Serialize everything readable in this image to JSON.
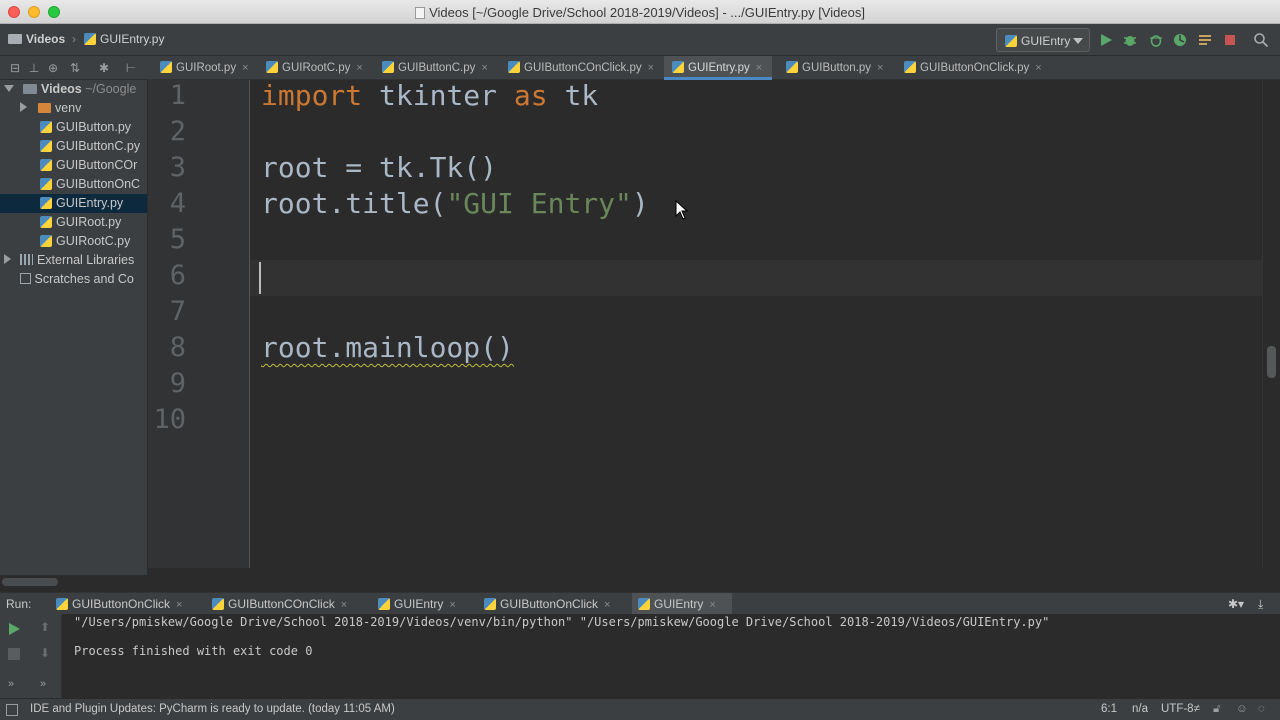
{
  "window": {
    "title": "Videos [~/Google Drive/School 2018-2019/Videos] - .../GUIEntry.py [Videos]"
  },
  "navbar": {
    "project": "Videos",
    "file": "GUIEntry.py",
    "run_config": "GUIEntry"
  },
  "tabs": [
    {
      "label": "GUIRoot.py"
    },
    {
      "label": "GUIRootC.py"
    },
    {
      "label": "GUIButtonC.py"
    },
    {
      "label": "GUIButtonCOnClick.py"
    },
    {
      "label": "GUIEntry.py",
      "active": true
    },
    {
      "label": "GUIButton.py"
    },
    {
      "label": "GUIButtonOnClick.py"
    }
  ],
  "tree": {
    "root_label": "Videos",
    "root_path": "~/Google",
    "items": [
      {
        "label": "venv"
      },
      {
        "label": "GUIButton.py"
      },
      {
        "label": "GUIButtonC.py"
      },
      {
        "label": "GUIButtonCOr"
      },
      {
        "label": "GUIButtonOnC"
      },
      {
        "label": "GUIEntry.py",
        "selected": true
      },
      {
        "label": "GUIRoot.py"
      },
      {
        "label": "GUIRootC.py"
      },
      {
        "label": "External Libraries"
      },
      {
        "label": "Scratches and Co"
      }
    ]
  },
  "editor": {
    "line_numbers": [
      "1",
      "2",
      "3",
      "4",
      "5",
      "6",
      "7",
      "8",
      "9",
      "10"
    ],
    "code": {
      "l1_kw1": "import",
      "l1_mod": " tkinter ",
      "l1_kw2": "as",
      "l1_alias": " tk",
      "l3": "root = tk.Tk()",
      "l4_pre": "root.title(",
      "l4_str": "\"GUI Entry\"",
      "l4_post": ")",
      "l8": "root.mainloop()"
    }
  },
  "run": {
    "label": "Run:",
    "tabs": [
      {
        "label": "GUIButtonOnClick"
      },
      {
        "label": "GUIButtonCOnClick"
      },
      {
        "label": "GUIEntry"
      },
      {
        "label": "GUIButtonOnClick"
      },
      {
        "label": "GUIEntry",
        "active": true
      }
    ],
    "console": {
      "command": "\"/Users/pmiskew/Google Drive/School 2018-2019/Videos/venv/bin/python\" \"/Users/pmiskew/Google Drive/School 2018-2019/Videos/GUIEntry.py\"",
      "result": "Process finished with exit code 0"
    }
  },
  "status": {
    "message": "IDE and Plugin Updates: PyCharm is ready to update. (today 11:05 AM)",
    "position": "6:1",
    "na": "n/a",
    "encoding": "UTF-8≠"
  },
  "colors": {
    "keyword": "#cc7832",
    "string": "#6a8759",
    "text": "#a9b7c6",
    "background": "#2b2b2b",
    "accent": "#4a88c7"
  }
}
